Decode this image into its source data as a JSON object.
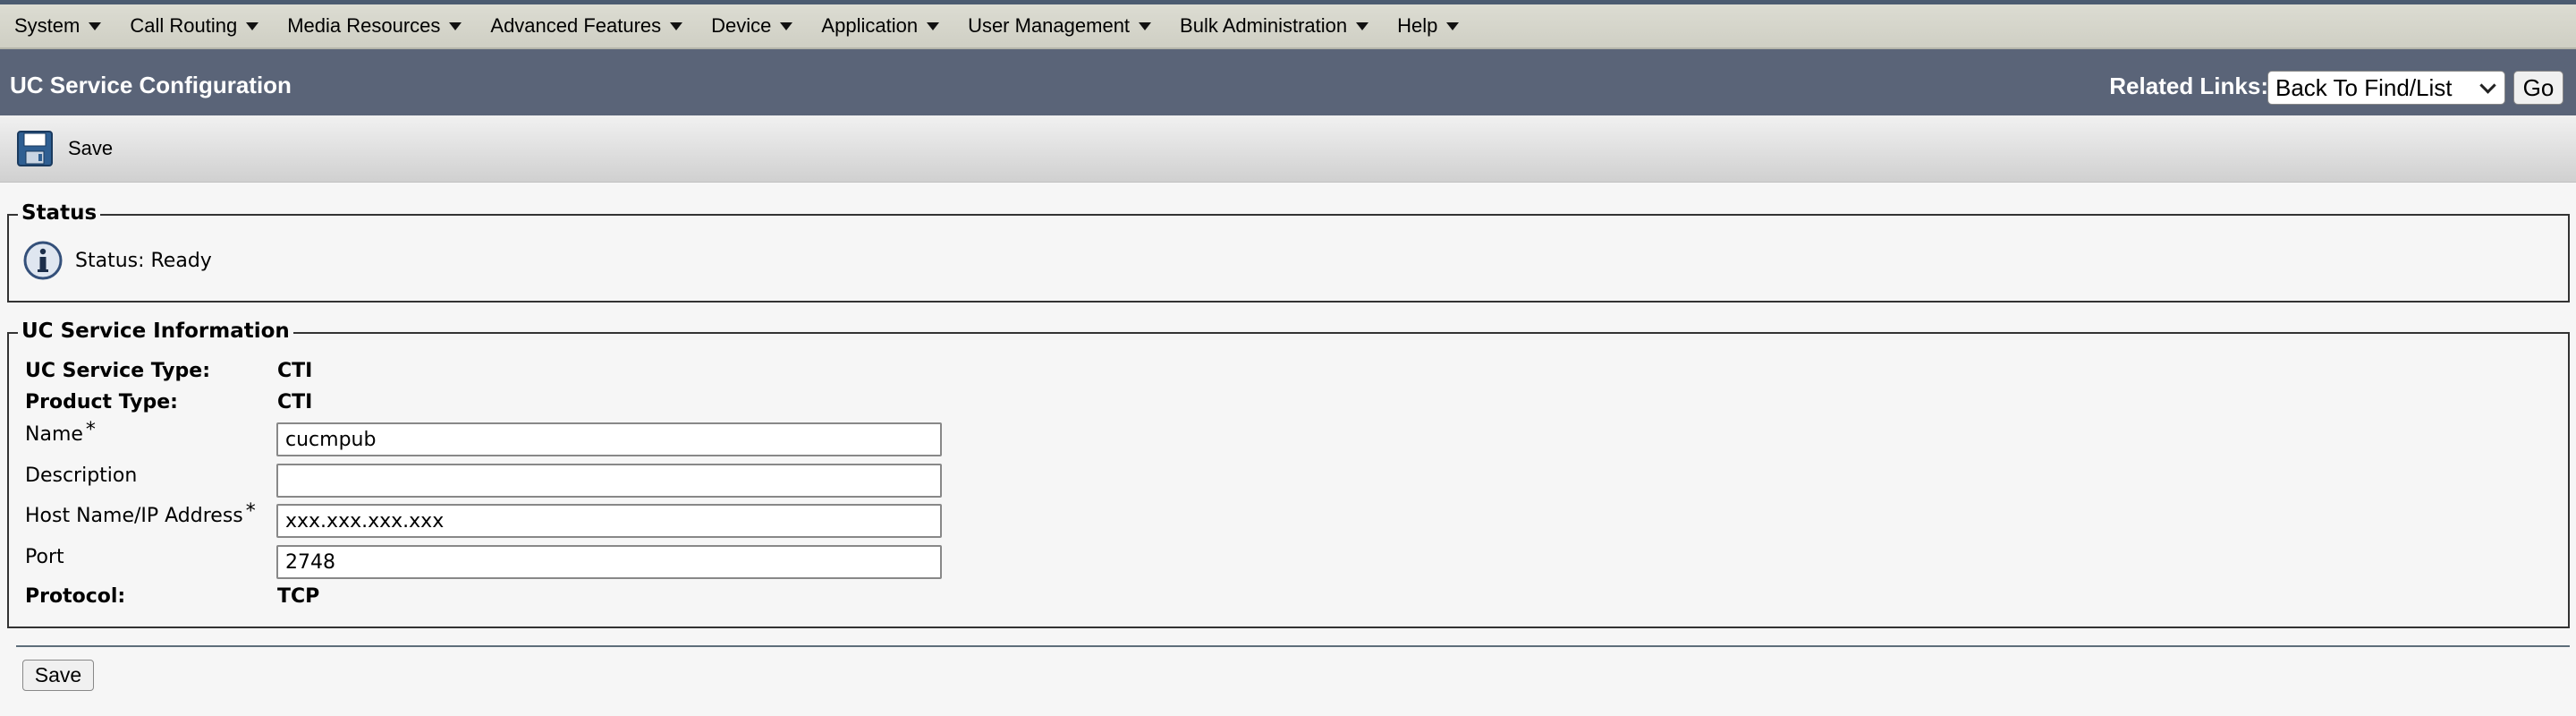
{
  "menu": [
    {
      "label": "System"
    },
    {
      "label": "Call Routing"
    },
    {
      "label": "Media Resources"
    },
    {
      "label": "Advanced Features"
    },
    {
      "label": "Device"
    },
    {
      "label": "Application"
    },
    {
      "label": "User Management"
    },
    {
      "label": "Bulk Administration"
    },
    {
      "label": "Help"
    }
  ],
  "header": {
    "title": "UC Service Configuration",
    "related_links_label": "Related Links:",
    "related_links_selected": "Back To Find/List",
    "go_label": "Go"
  },
  "toolbar": {
    "save_label": "Save",
    "save_icon": "floppy-disk-icon"
  },
  "status": {
    "legend": "Status",
    "icon": "info-icon",
    "text": "Status: Ready"
  },
  "uc_info": {
    "legend": "UC Service Information",
    "service_type_label": "UC Service Type:",
    "service_type_value": "CTI",
    "product_type_label": "Product Type:",
    "product_type_value": "CTI",
    "name_label": "Name",
    "name_value": "cucmpub",
    "description_label": "Description",
    "description_value": "",
    "host_label": "Host Name/IP Address",
    "host_value": "xxx.xxx.xxx.xxx",
    "port_label": "Port",
    "port_value": "2748",
    "protocol_label": "Protocol:",
    "protocol_value": "TCP",
    "required_mark": "*"
  },
  "footer": {
    "save_label": "Save"
  },
  "colors": {
    "title_bar": "#5a6478",
    "menu_bar": "#d6d6cc",
    "background": "#f6f6f6"
  }
}
